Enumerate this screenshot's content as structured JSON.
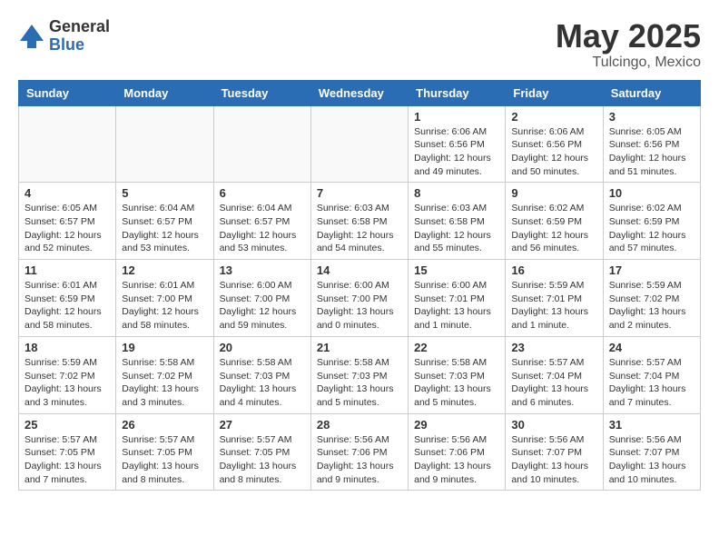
{
  "header": {
    "logo_general": "General",
    "logo_blue": "Blue",
    "month_title": "May 2025",
    "location": "Tulcingo, Mexico"
  },
  "days_of_week": [
    "Sunday",
    "Monday",
    "Tuesday",
    "Wednesday",
    "Thursday",
    "Friday",
    "Saturday"
  ],
  "weeks": [
    [
      {
        "day": "",
        "info": ""
      },
      {
        "day": "",
        "info": ""
      },
      {
        "day": "",
        "info": ""
      },
      {
        "day": "",
        "info": ""
      },
      {
        "day": "1",
        "info": "Sunrise: 6:06 AM\nSunset: 6:56 PM\nDaylight: 12 hours\nand 49 minutes."
      },
      {
        "day": "2",
        "info": "Sunrise: 6:06 AM\nSunset: 6:56 PM\nDaylight: 12 hours\nand 50 minutes."
      },
      {
        "day": "3",
        "info": "Sunrise: 6:05 AM\nSunset: 6:56 PM\nDaylight: 12 hours\nand 51 minutes."
      }
    ],
    [
      {
        "day": "4",
        "info": "Sunrise: 6:05 AM\nSunset: 6:57 PM\nDaylight: 12 hours\nand 52 minutes."
      },
      {
        "day": "5",
        "info": "Sunrise: 6:04 AM\nSunset: 6:57 PM\nDaylight: 12 hours\nand 53 minutes."
      },
      {
        "day": "6",
        "info": "Sunrise: 6:04 AM\nSunset: 6:57 PM\nDaylight: 12 hours\nand 53 minutes."
      },
      {
        "day": "7",
        "info": "Sunrise: 6:03 AM\nSunset: 6:58 PM\nDaylight: 12 hours\nand 54 minutes."
      },
      {
        "day": "8",
        "info": "Sunrise: 6:03 AM\nSunset: 6:58 PM\nDaylight: 12 hours\nand 55 minutes."
      },
      {
        "day": "9",
        "info": "Sunrise: 6:02 AM\nSunset: 6:59 PM\nDaylight: 12 hours\nand 56 minutes."
      },
      {
        "day": "10",
        "info": "Sunrise: 6:02 AM\nSunset: 6:59 PM\nDaylight: 12 hours\nand 57 minutes."
      }
    ],
    [
      {
        "day": "11",
        "info": "Sunrise: 6:01 AM\nSunset: 6:59 PM\nDaylight: 12 hours\nand 58 minutes."
      },
      {
        "day": "12",
        "info": "Sunrise: 6:01 AM\nSunset: 7:00 PM\nDaylight: 12 hours\nand 58 minutes."
      },
      {
        "day": "13",
        "info": "Sunrise: 6:00 AM\nSunset: 7:00 PM\nDaylight: 12 hours\nand 59 minutes."
      },
      {
        "day": "14",
        "info": "Sunrise: 6:00 AM\nSunset: 7:00 PM\nDaylight: 13 hours\nand 0 minutes."
      },
      {
        "day": "15",
        "info": "Sunrise: 6:00 AM\nSunset: 7:01 PM\nDaylight: 13 hours\nand 1 minute."
      },
      {
        "day": "16",
        "info": "Sunrise: 5:59 AM\nSunset: 7:01 PM\nDaylight: 13 hours\nand 1 minute."
      },
      {
        "day": "17",
        "info": "Sunrise: 5:59 AM\nSunset: 7:02 PM\nDaylight: 13 hours\nand 2 minutes."
      }
    ],
    [
      {
        "day": "18",
        "info": "Sunrise: 5:59 AM\nSunset: 7:02 PM\nDaylight: 13 hours\nand 3 minutes."
      },
      {
        "day": "19",
        "info": "Sunrise: 5:58 AM\nSunset: 7:02 PM\nDaylight: 13 hours\nand 3 minutes."
      },
      {
        "day": "20",
        "info": "Sunrise: 5:58 AM\nSunset: 7:03 PM\nDaylight: 13 hours\nand 4 minutes."
      },
      {
        "day": "21",
        "info": "Sunrise: 5:58 AM\nSunset: 7:03 PM\nDaylight: 13 hours\nand 5 minutes."
      },
      {
        "day": "22",
        "info": "Sunrise: 5:58 AM\nSunset: 7:03 PM\nDaylight: 13 hours\nand 5 minutes."
      },
      {
        "day": "23",
        "info": "Sunrise: 5:57 AM\nSunset: 7:04 PM\nDaylight: 13 hours\nand 6 minutes."
      },
      {
        "day": "24",
        "info": "Sunrise: 5:57 AM\nSunset: 7:04 PM\nDaylight: 13 hours\nand 7 minutes."
      }
    ],
    [
      {
        "day": "25",
        "info": "Sunrise: 5:57 AM\nSunset: 7:05 PM\nDaylight: 13 hours\nand 7 minutes."
      },
      {
        "day": "26",
        "info": "Sunrise: 5:57 AM\nSunset: 7:05 PM\nDaylight: 13 hours\nand 8 minutes."
      },
      {
        "day": "27",
        "info": "Sunrise: 5:57 AM\nSunset: 7:05 PM\nDaylight: 13 hours\nand 8 minutes."
      },
      {
        "day": "28",
        "info": "Sunrise: 5:56 AM\nSunset: 7:06 PM\nDaylight: 13 hours\nand 9 minutes."
      },
      {
        "day": "29",
        "info": "Sunrise: 5:56 AM\nSunset: 7:06 PM\nDaylight: 13 hours\nand 9 minutes."
      },
      {
        "day": "30",
        "info": "Sunrise: 5:56 AM\nSunset: 7:07 PM\nDaylight: 13 hours\nand 10 minutes."
      },
      {
        "day": "31",
        "info": "Sunrise: 5:56 AM\nSunset: 7:07 PM\nDaylight: 13 hours\nand 10 minutes."
      }
    ]
  ]
}
